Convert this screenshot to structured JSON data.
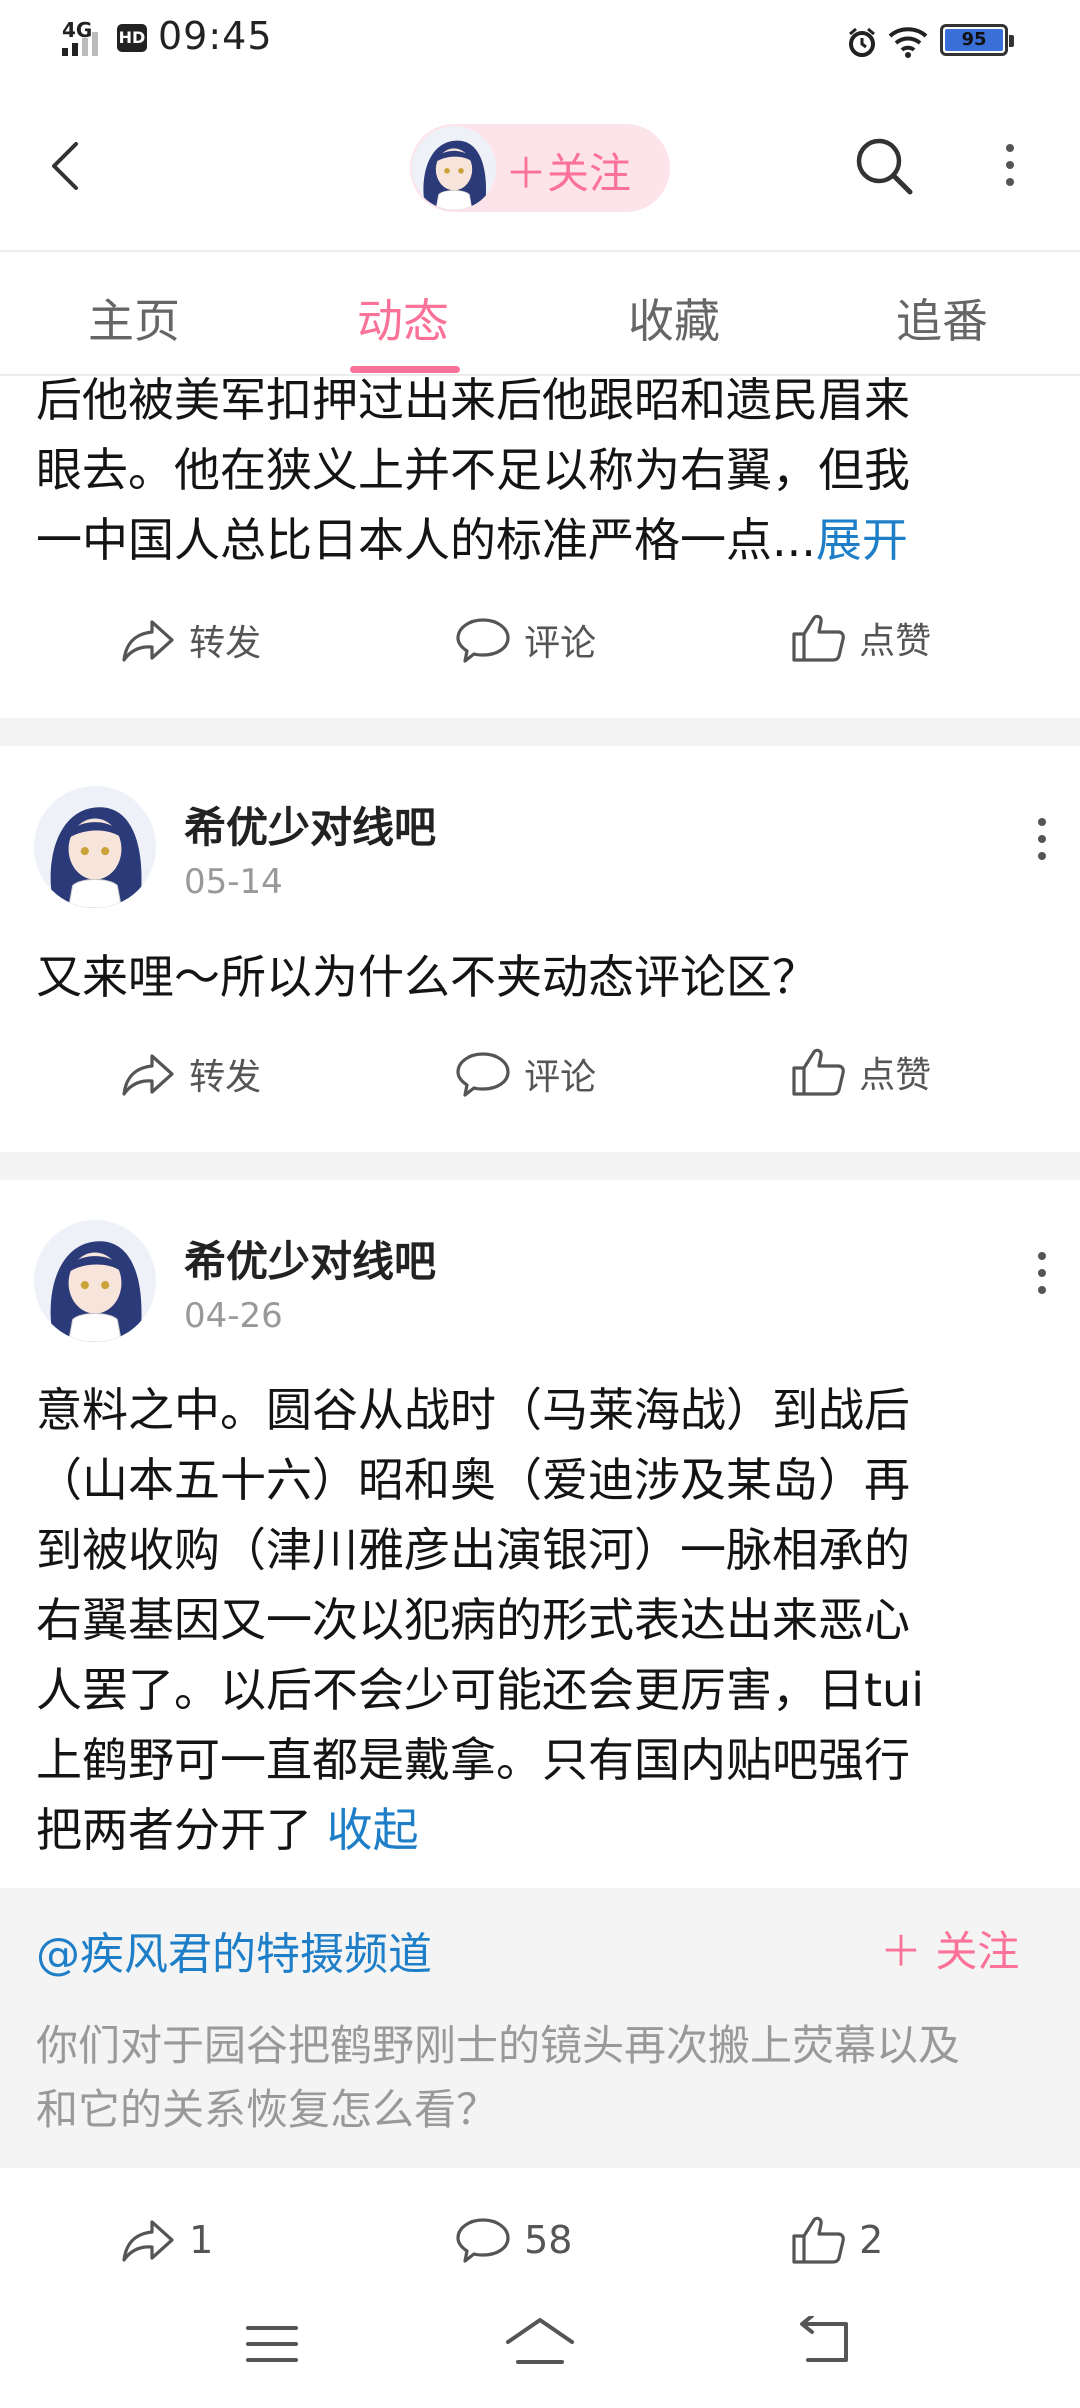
{
  "status_bar": {
    "network": "4G",
    "hd": "HD",
    "time": "09:45",
    "battery": "95"
  },
  "header": {
    "follow_label": "＋关注"
  },
  "tabs": [
    {
      "label": "主页"
    },
    {
      "label": "动态"
    },
    {
      "label": "收藏"
    },
    {
      "label": "追番"
    }
  ],
  "active_tab": "动态",
  "post0": {
    "lines": [
      "后他被美军扣押过出来后他跟昭和遗民眉来",
      "眼去。他在狭义上并不足以称为右翼，但我",
      "一中国人总比日本人的标准严格一点..."
    ],
    "expand": "展开",
    "actions": {
      "forward": "转发",
      "comment": "评论",
      "like": "点赞"
    }
  },
  "post1": {
    "username": "希优少对线吧",
    "date": "05-14",
    "text": "又来哩～所以为什么不夹动态评论区？",
    "actions": {
      "forward": "转发",
      "comment": "评论",
      "like": "点赞"
    }
  },
  "post2": {
    "username": "希优少对线吧",
    "date": "04-26",
    "lines": [
      "意料之中。圆谷从战时（马莱海战）到战后",
      "（山本五十六）昭和奥（爱迪涉及某岛）再",
      "到被收购（津川雅彦出演银河）一脉相承的",
      "右翼基因又一次以犯病的形式表达出来恶心",
      "人罢了。以后不会少可能还会更厉害，日tui",
      "上鹤野可一直都是戴拿。只有国内贴吧强行",
      "把两者分开了 "
    ],
    "collapse": "收起",
    "repost": {
      "user": "@疾风君的特摄频道",
      "follow": "＋ 关注",
      "lines": [
        "你们对于园谷把鹤野刚士的镜头再次搬上荧幕以及",
        "和它的关系恢复怎么看？"
      ]
    },
    "stats": {
      "forward": "1",
      "comment": "58",
      "like": "2"
    }
  },
  "colors": {
    "accent": "#fb7299",
    "link": "#1e7fc8",
    "separator": "#f4f4f4"
  }
}
